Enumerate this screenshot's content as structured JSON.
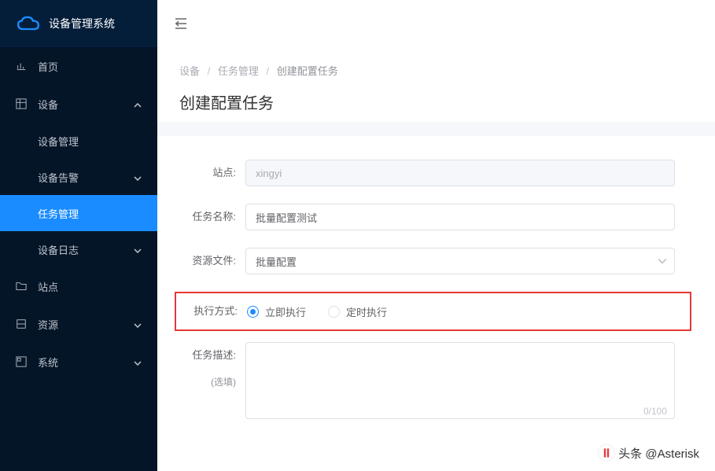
{
  "app": {
    "name": "设备管理系统"
  },
  "sidebar": {
    "home": "首页",
    "device": "设备",
    "deviceMgmt": "设备管理",
    "deviceAlarm": "设备告警",
    "taskMgmt": "任务管理",
    "deviceLog": "设备日志",
    "site": "站点",
    "resource": "资源",
    "system": "系统"
  },
  "breadcrumb": {
    "a": "设备",
    "b": "任务管理",
    "c": "创建配置任务"
  },
  "page": {
    "title": "创建配置任务"
  },
  "form": {
    "siteLabel": "站点:",
    "siteValue": "xingyi",
    "taskNameLabel": "任务名称:",
    "taskNameValue": "批量配置测试",
    "resourceLabel": "资源文件:",
    "resourceValue": "批量配置",
    "execModeLabel": "执行方式:",
    "execNow": "立即执行",
    "execSchedule": "定时执行",
    "descLabel": "任务描述:",
    "descSub": "(选填)",
    "counter": "0/100"
  },
  "watermark": "头条 @Asterisk"
}
